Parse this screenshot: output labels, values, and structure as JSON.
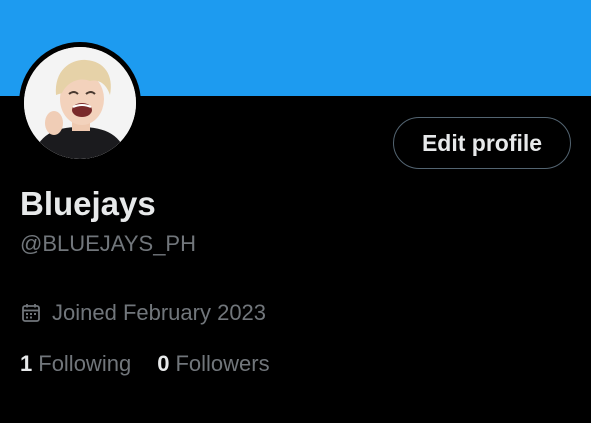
{
  "profile": {
    "banner_color": "#1d9bf0",
    "display_name": "Bluejays",
    "handle": "@BLUEJAYS_PH",
    "joined": "Joined February 2023",
    "edit_button": "Edit profile"
  },
  "stats": {
    "following_count": "1",
    "following_label": "Following",
    "followers_count": "0",
    "followers_label": "Followers"
  },
  "icons": {
    "joined": "calendar-icon",
    "avatar": "profile-photo"
  }
}
